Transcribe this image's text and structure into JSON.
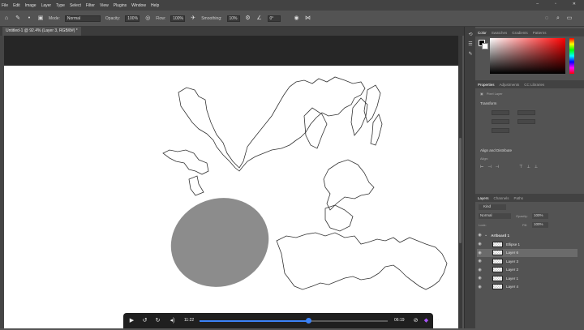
{
  "menu": [
    "File",
    "Edit",
    "Image",
    "Layer",
    "Type",
    "Select",
    "Filter",
    "View",
    "Plugins",
    "Window",
    "Help"
  ],
  "options_bar": {
    "mode_label": "Mode:",
    "mode_value": "Normal",
    "opacity_label": "Opacity:",
    "opacity_value": "100%",
    "flow_label": "Flow:",
    "flow_value": "100%",
    "smoothing_label": "Smoothing:",
    "smoothing_value": "10%",
    "angle_value": "0°"
  },
  "document_tab": "Untitled-1 @ 92.4% (Layer 3, RGB/8#) *",
  "color_panel": {
    "tabs": [
      "Color",
      "Swatches",
      "Gradients",
      "Patterns"
    ],
    "active_tab": "Color",
    "hue_color": "#ff0000"
  },
  "properties_panel": {
    "tabs": [
      "Properties",
      "Adjustments",
      "CC Libraries"
    ],
    "active_tab": "Properties",
    "layer_type": "Pixel Layer",
    "transform_label": "Transform",
    "align_label": "Align and Distribute",
    "align_sub": "Align:"
  },
  "layers_panel": {
    "tabs": [
      "Layers",
      "Channels",
      "Paths"
    ],
    "active_tab": "Layers",
    "filter_label": "Kind",
    "blend_mode": "Normal",
    "opacity_label": "Opacity:",
    "opacity_value": "100%",
    "lock_label": "Lock:",
    "fill_label": "Fill:",
    "fill_value": "100%",
    "artboard": "Artboard 1",
    "layers": [
      {
        "name": "Ellipse 1",
        "selected": false
      },
      {
        "name": "Layer 6",
        "selected": true
      },
      {
        "name": "Layer 3",
        "selected": false
      },
      {
        "name": "Layer 2",
        "selected": false
      },
      {
        "name": "Layer 1",
        "selected": false
      },
      {
        "name": "Layer 4",
        "selected": false
      }
    ]
  },
  "video_player": {
    "current_time": "11:22",
    "duration": "06:19",
    "progress": 0.58,
    "accent": "#3b82f6"
  },
  "canvas_shape_fill": "#8c8c8c"
}
